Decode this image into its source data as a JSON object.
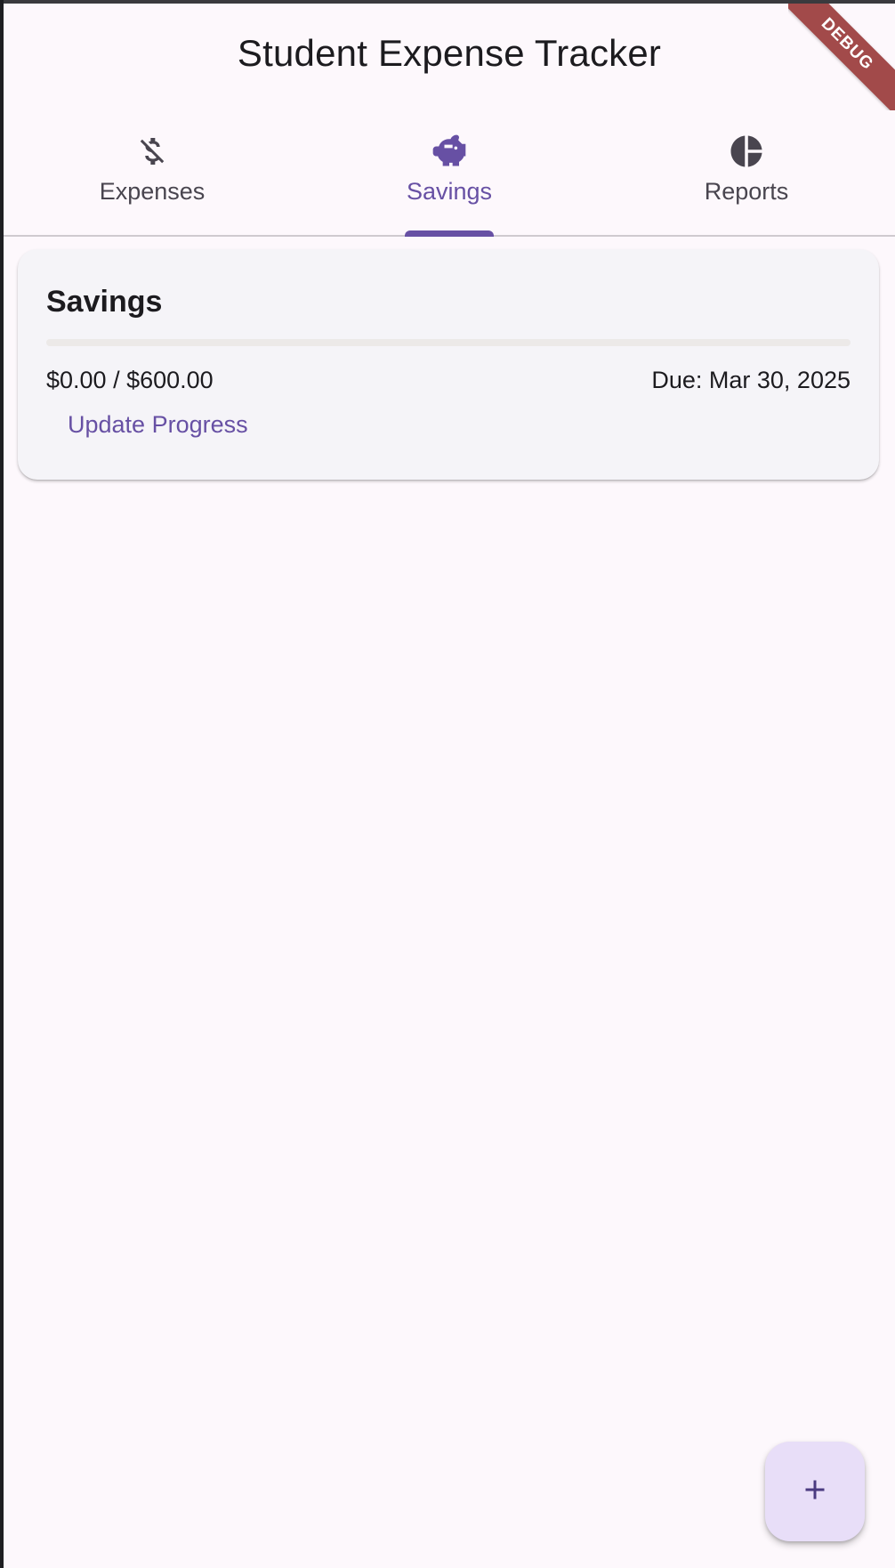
{
  "app": {
    "title": "Student Expense Tracker",
    "debug_label": "DEBUG"
  },
  "tabs": [
    {
      "label": "Expenses",
      "icon": "money-off-icon",
      "active": false
    },
    {
      "label": "Savings",
      "icon": "piggy-bank-icon",
      "active": true
    },
    {
      "label": "Reports",
      "icon": "pie-chart-icon",
      "active": false
    }
  ],
  "savings_card": {
    "title": "Savings",
    "amounts": "$0.00 / $600.00",
    "due": "Due: Mar 30, 2025",
    "progress": 0,
    "update_label": "Update Progress"
  },
  "fab": {
    "icon": "add-icon"
  },
  "colors": {
    "accent": "#6750a4",
    "background": "#fdf8fc",
    "card": "#f5f4f8",
    "fab": "#e8def8",
    "debug_banner": "#a24a4a"
  }
}
